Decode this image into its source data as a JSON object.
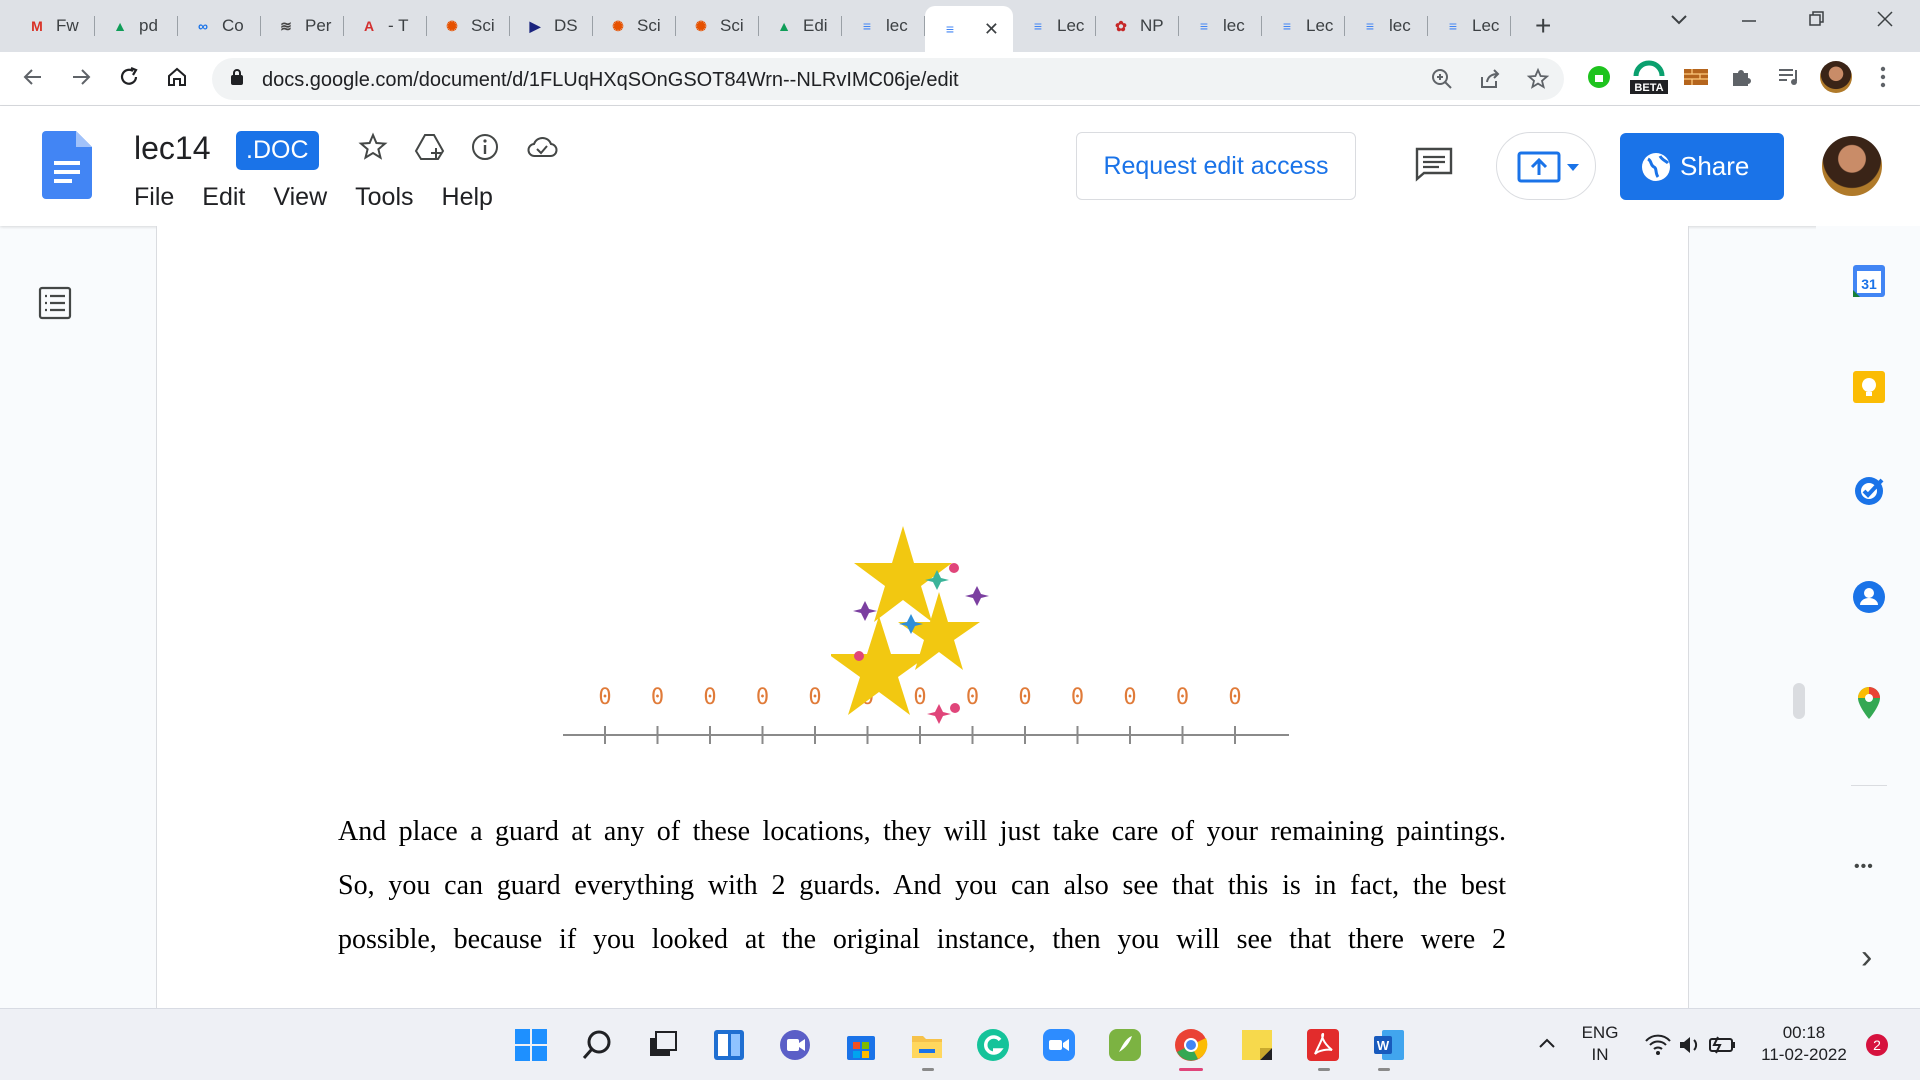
{
  "browser": {
    "tabs": [
      {
        "label": "Fw",
        "icon": "gmail-icon",
        "color": "#d93025",
        "glyph": "M"
      },
      {
        "label": "pd",
        "icon": "drive-icon",
        "color": "#0f9d58",
        "glyph": "▲"
      },
      {
        "label": "Co",
        "icon": "link-icon",
        "color": "#1a73e8",
        "glyph": "∞"
      },
      {
        "label": "Per",
        "icon": "perplexity-icon",
        "color": "#444444",
        "glyph": "≋"
      },
      {
        "label": "- T",
        "icon": "acrobat-icon",
        "color": "#d32f2f",
        "glyph": "A"
      },
      {
        "label": "Sci",
        "icon": "scihub-icon",
        "color": "#e65100",
        "glyph": "✺"
      },
      {
        "label": "DS",
        "icon": "ds-icon",
        "color": "#1a237e",
        "glyph": "▶"
      },
      {
        "label": "Sci",
        "icon": "scihub-icon",
        "color": "#e65100",
        "glyph": "✺"
      },
      {
        "label": "Sci",
        "icon": "scihub-icon",
        "color": "#e65100",
        "glyph": "✺"
      },
      {
        "label": "Edi",
        "icon": "drive-icon",
        "color": "#0f9d58",
        "glyph": "▲"
      },
      {
        "label": "lec",
        "icon": "docs-icon",
        "color": "#4285f4",
        "glyph": "≡"
      },
      {
        "label": "",
        "icon": "docs-icon",
        "color": "#4285f4",
        "glyph": "≡",
        "active": true
      },
      {
        "label": "Lec",
        "icon": "docs-icon",
        "color": "#4285f4",
        "glyph": "≡"
      },
      {
        "label": "NP",
        "icon": "nptel-icon",
        "color": "#c62828",
        "glyph": "✿"
      },
      {
        "label": "lec",
        "icon": "docs-icon",
        "color": "#4285f4",
        "glyph": "≡"
      },
      {
        "label": "Lec",
        "icon": "docs-icon",
        "color": "#4285f4",
        "glyph": "≡"
      },
      {
        "label": "lec",
        "icon": "docs-icon",
        "color": "#4285f4",
        "glyph": "≡"
      },
      {
        "label": "Lec",
        "icon": "docs-icon",
        "color": "#4285f4",
        "glyph": "≡"
      }
    ],
    "close_glyph": "✕",
    "new_tab_glyph": "+",
    "url": "docs.google.com/document/d/1FLUqHXqSOnGSOT84Wrn--NLRvIMC06je/edit",
    "beta_label": "BETA"
  },
  "doc": {
    "title": "lec14",
    "badge": ".DOC",
    "menu": [
      "File",
      "Edit",
      "View",
      "Tools",
      "Help"
    ],
    "request_edit": "Request edit access",
    "share": "Share"
  },
  "figure": {
    "tick_label": "0",
    "tick_count": 13,
    "accent_color": "#e07b39",
    "star_color": "#f2c811"
  },
  "body_lines": [
    "And place a guard at any of these locations, they will just take care of your remaining paintings.",
    "So, you can guard everything with 2 guards. And you can also see that this is in fact, the best",
    "possible, because if you looked at the original instance, then you will see that there were 2"
  ],
  "side_panel": {
    "calendar_day": "31",
    "more_glyph": "•••",
    "expand_glyph": "›"
  },
  "taskbar": {
    "lang_top": "ENG",
    "lang_bottom": "IN",
    "time": "00:18",
    "date": "11-02-2022",
    "notifications": "2"
  }
}
